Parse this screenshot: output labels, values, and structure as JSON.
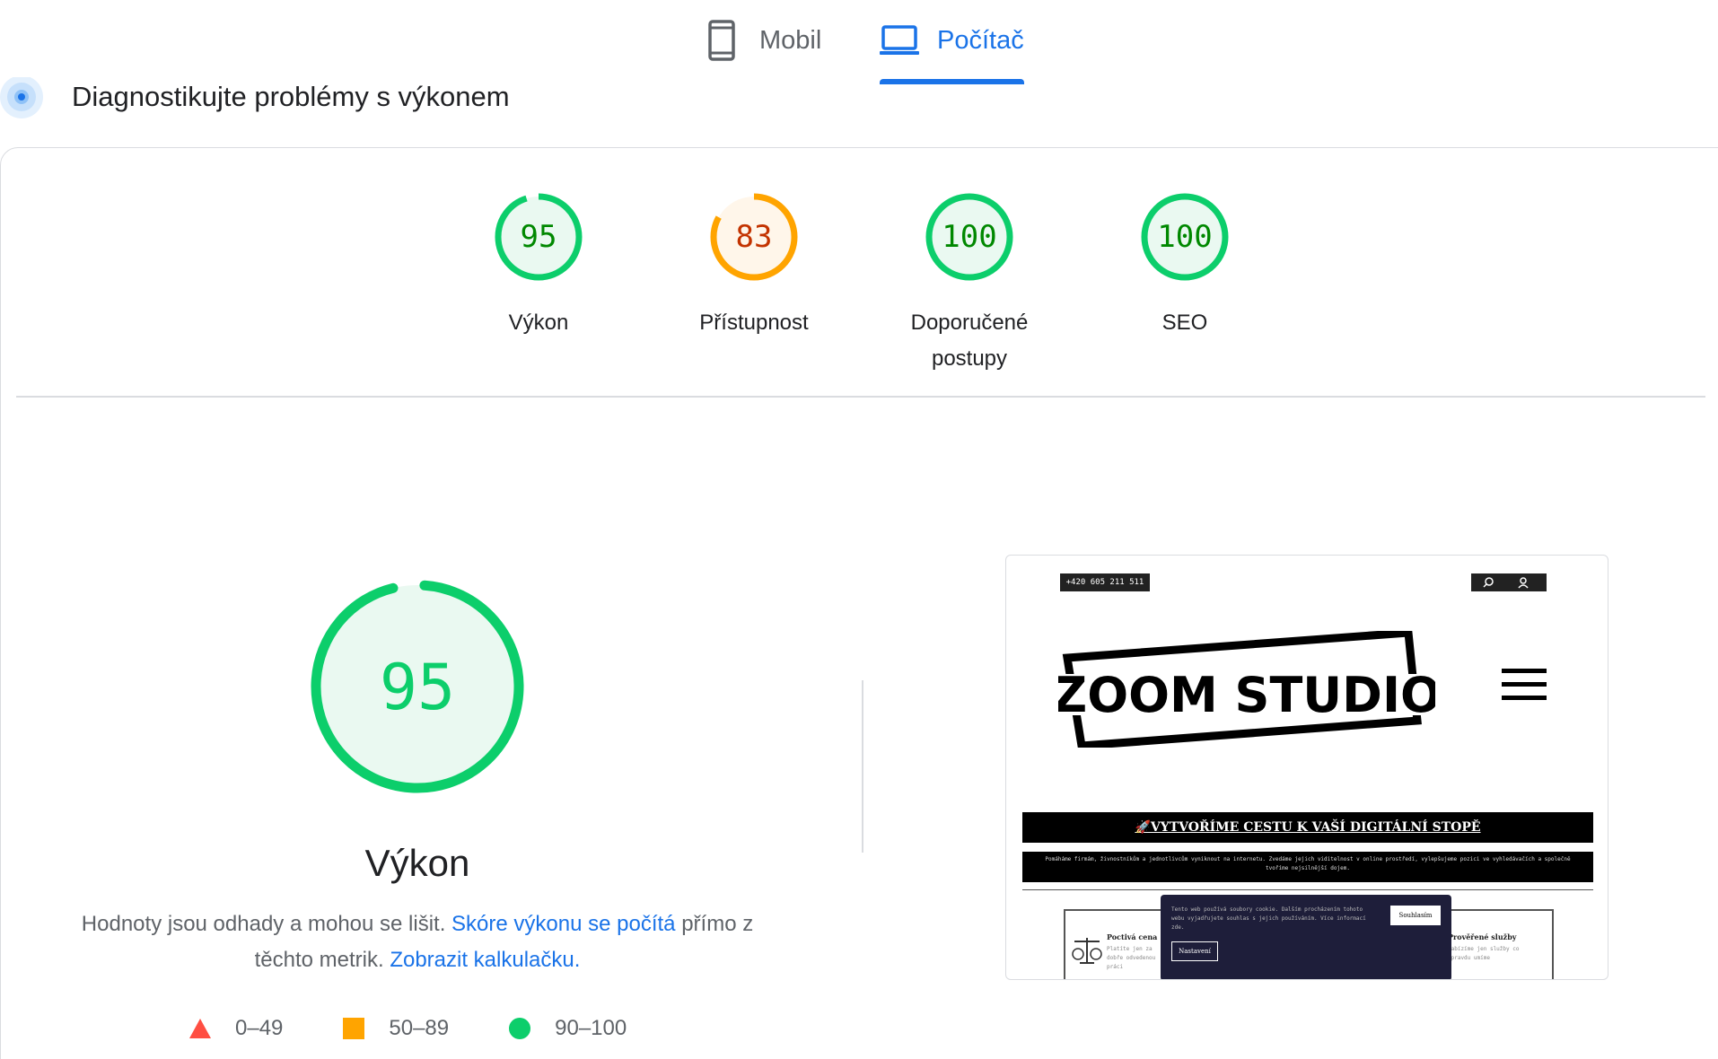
{
  "tabs": [
    {
      "label": "Mobil",
      "active": false
    },
    {
      "label": "Počítač",
      "active": true
    }
  ],
  "header": {
    "title": "Diagnostikujte problémy s výkonem"
  },
  "colors": {
    "pass": "#0cce6b",
    "average": "#ffa400",
    "fail": "#ff4e42",
    "link": "#1a73e8"
  },
  "gauges": [
    {
      "score": "95",
      "label": "Výkon",
      "rating": "pass"
    },
    {
      "score": "83",
      "label": "Přístupnost",
      "rating": "average"
    },
    {
      "score": "100",
      "label": "Doporučené postupy",
      "rating": "pass"
    },
    {
      "score": "100",
      "label": "SEO",
      "rating": "pass"
    }
  ],
  "performance": {
    "score": "95",
    "title": "Výkon",
    "desc_prefix": "Hodnoty jsou odhady a mohou se lišit.",
    "desc_link1": "Skóre výkonu se počítá",
    "desc_middle": "přímo z těchto metrik.",
    "desc_link2": "Zobrazit kalkulačku."
  },
  "legend": [
    {
      "range": "0–49",
      "shape": "triangle",
      "rating": "fail"
    },
    {
      "range": "50–89",
      "shape": "square",
      "rating": "average"
    },
    {
      "range": "90–100",
      "shape": "circle",
      "rating": "pass"
    }
  ],
  "screenshot": {
    "phone": "+420 605 211 511",
    "logo_text": "ZOOM STUDIO",
    "banner": "🚀VYTVOŘÍME CESTU K VAŠÍ DIGITÁLNÍ STOPĚ",
    "subtext": "Pomáháme firmám, živnostníkům a jednotlivcům vyniknout na internetu. Zvedáme jejich viditelnost v online prostředí, vylepšujeme pozici ve vyhledávačích a společně tvoříme nejsilnější dojem.",
    "cookie_text": "Tento web používá soubory cookie. Dalším procházením tohoto webu vyjadřujete souhlas s jejich používáním. Více informací zde.",
    "cookie_accept": "Souhlasím",
    "cookie_settings": "Nastavení",
    "card_left_title": "Poctivá cena",
    "card_left_text": "Platíte jen za dobře odvedenou práci",
    "card_right_title": "Prověřené služby",
    "card_right_text": "Nabízíme jen služby co opravdu umíme"
  }
}
